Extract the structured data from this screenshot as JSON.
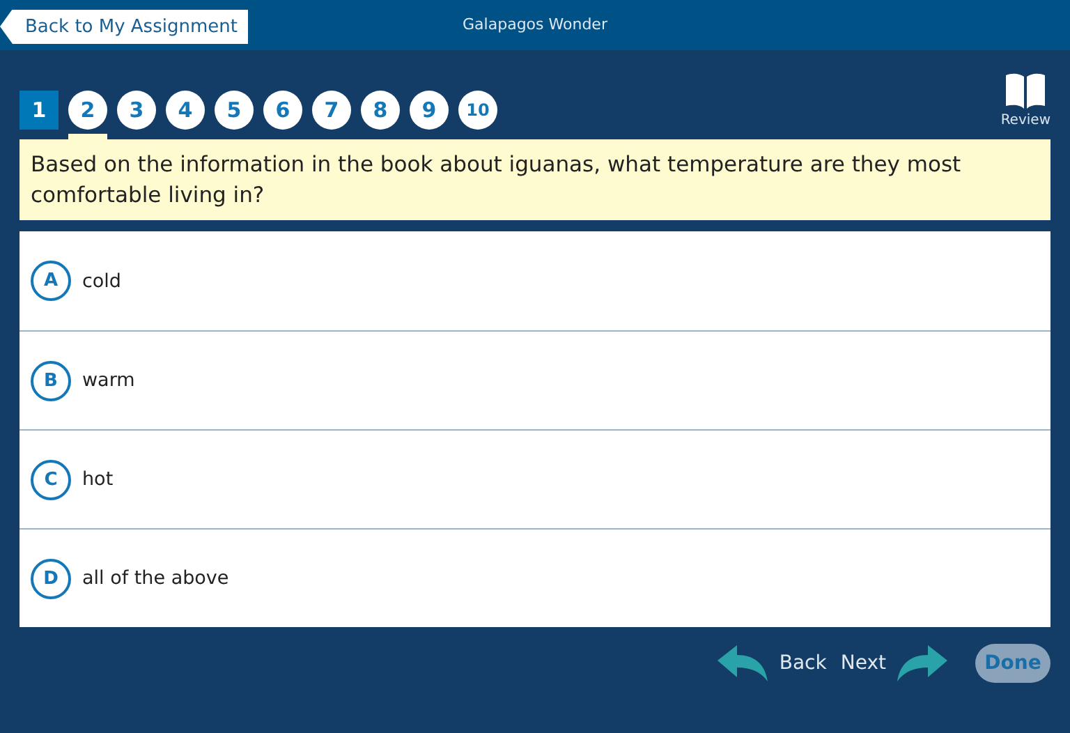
{
  "header": {
    "back_link": "Back to My Assignment",
    "title": "Galapagos Wonder"
  },
  "questions": [
    {
      "label": "1",
      "selected": true,
      "underlined": false
    },
    {
      "label": "2",
      "selected": false,
      "underlined": true
    },
    {
      "label": "3",
      "selected": false,
      "underlined": false
    },
    {
      "label": "4",
      "selected": false,
      "underlined": false
    },
    {
      "label": "5",
      "selected": false,
      "underlined": false
    },
    {
      "label": "6",
      "selected": false,
      "underlined": false
    },
    {
      "label": "7",
      "selected": false,
      "underlined": false
    },
    {
      "label": "8",
      "selected": false,
      "underlined": false
    },
    {
      "label": "9",
      "selected": false,
      "underlined": false
    },
    {
      "label": "10",
      "selected": false,
      "underlined": false
    }
  ],
  "review": {
    "label": "Review"
  },
  "question": "Based on the information in the book about iguanas, what temperature are they most comfortable living in?",
  "answers": [
    {
      "letter": "A",
      "text": "cold",
      "selected": false
    },
    {
      "letter": "B",
      "text": "warm",
      "selected": false
    },
    {
      "letter": "C",
      "text": "hot",
      "selected": false
    },
    {
      "letter": "D",
      "text": "all of the above",
      "selected": false
    }
  ],
  "footer": {
    "back": "Back",
    "next": "Next",
    "done": {
      "label": "Done",
      "disabled": true
    }
  }
}
